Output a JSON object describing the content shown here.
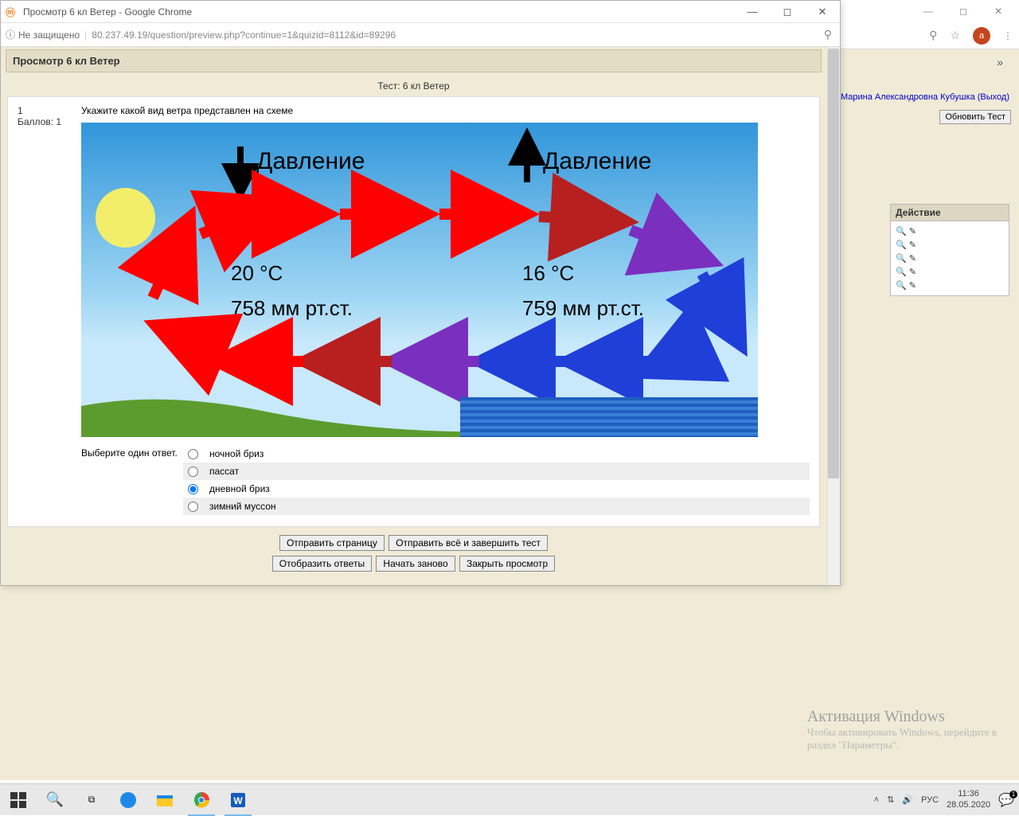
{
  "bg": {
    "user_link": "Марина Александровна Кубушка (Выход)",
    "update_btn": "Обновить Тест",
    "action_header": "Действие",
    "avatar_letter": "a",
    "chevron": "»"
  },
  "fg": {
    "window_title": "Просмотр 6 кл Ветер - Google Chrome",
    "insecure": "Не защищено",
    "url": "80.237.49.19/question/preview.php?continue=1&quizid=8112&id=89296",
    "page_header": "Просмотр 6 кл Ветер",
    "test_title": "Тест: 6 кл Ветер"
  },
  "question": {
    "number": "1",
    "points": "Баллов: 1",
    "text": "Укажите какой вид ветра представлен на схеме",
    "answer_prompt": "Выберите один ответ.",
    "options": [
      "ночной бриз",
      "пассат",
      "дневной бриз",
      "зимний муссон"
    ],
    "selected_index": 2
  },
  "diagram": {
    "pressure_left": "Давление",
    "pressure_right": "Давление",
    "temp_left": "20 °C",
    "press_left": "758 мм рт.ст.",
    "temp_right": "16 °C",
    "press_right": "759 мм рт.ст."
  },
  "buttons": {
    "submit_page": "Отправить страницу",
    "submit_all": "Отправить всё и завершить тест",
    "show_answers": "Отобразить ответы",
    "restart": "Начать заново",
    "close": "Закрыть просмотр"
  },
  "watermark": {
    "l1": "Активация Windows",
    "l2": "Чтобы активировать Windows, перейдите в",
    "l3": "раздел \"Параметры\"."
  },
  "taskbar": {
    "time": "11:36",
    "date": "28.05.2020",
    "lang": "РУС"
  }
}
